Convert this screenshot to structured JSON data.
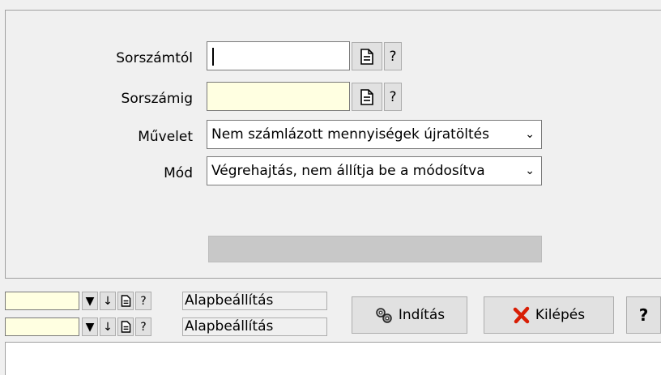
{
  "form": {
    "from_label": "Sorszámtól",
    "from_value": "",
    "to_label": "Sorszámig",
    "to_value": "",
    "help_label": "?",
    "operation_label": "Művelet",
    "operation_value": "Nem számlázott mennyiségek újratöltés",
    "mode_label": "Mód",
    "mode_value": "Végrehajtás, nem állítja be a módosítva"
  },
  "settings": {
    "row1_label": "Alapbeállítás",
    "row2_label": "Alapbeállítás",
    "help": "?"
  },
  "buttons": {
    "start_label": "Indítás",
    "exit_label": "Kilépés",
    "help_label": "?"
  },
  "colors": {
    "required_field": "#ffffe1",
    "exit_icon": "#d81e05"
  }
}
